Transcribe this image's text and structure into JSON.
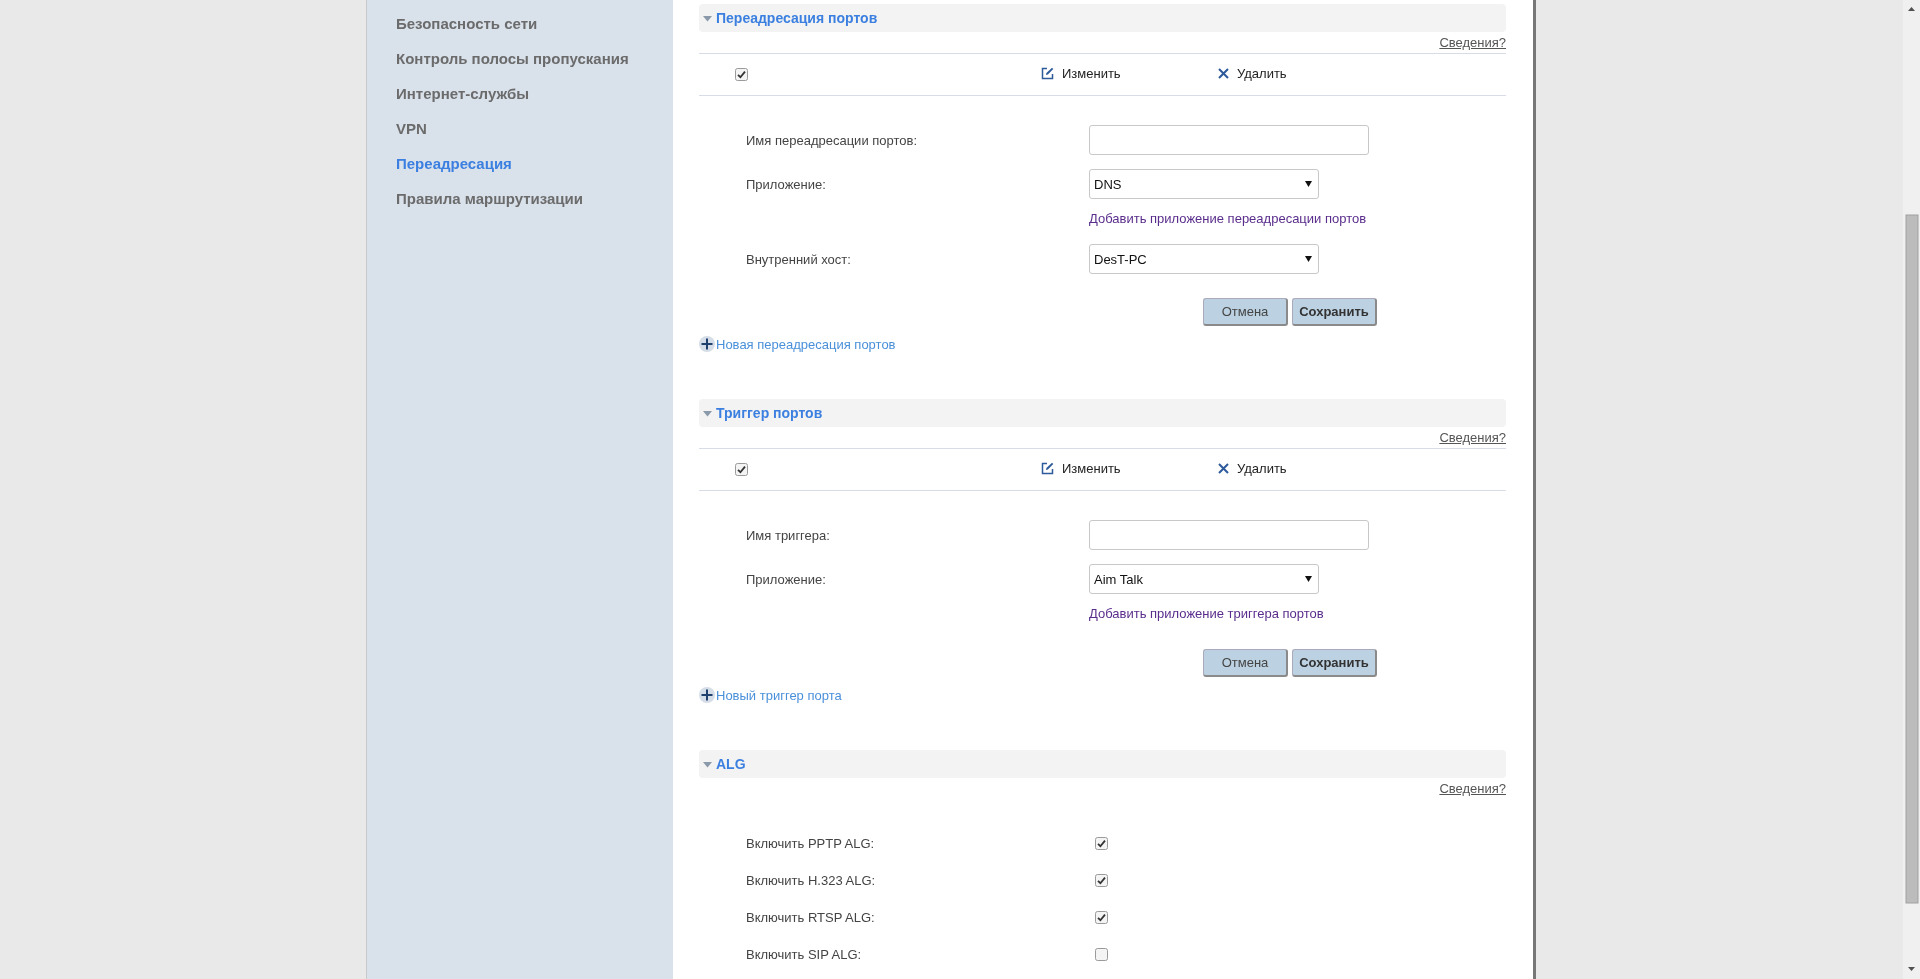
{
  "sidebar": {
    "items": [
      {
        "label": "Безопасность сети",
        "selected": false
      },
      {
        "label": "Контроль полосы пропускания",
        "selected": false
      },
      {
        "label": "Интернет-службы",
        "selected": false
      },
      {
        "label": "VPN",
        "selected": false
      },
      {
        "label": "Переадресация",
        "selected": true
      },
      {
        "label": "Правила маршрутизации",
        "selected": false
      }
    ]
  },
  "sections": [
    {
      "kind": "list-form",
      "title": "Переадресация портов",
      "expanded": true,
      "help_link": "Сведения?",
      "toolbar": {
        "select_all_checked": true,
        "edit": "Изменить",
        "delete": "Удалить"
      },
      "fields": [
        {
          "kind": "text",
          "label": "Имя переадресации портов:"
        },
        {
          "kind": "select",
          "label": "Приложение:",
          "value": "DNS",
          "link": "Добавить приложение переадресации портов"
        },
        {
          "kind": "select",
          "label": "Внутренний хост:",
          "value": "DesT-PC"
        }
      ],
      "buttons": [
        "Отмена",
        "Сохранить"
      ],
      "add_link": "Новая переадресация портов"
    },
    {
      "kind": "list-form",
      "title": "Триггер портов",
      "expanded": true,
      "help_link": "Сведения?",
      "toolbar": {
        "select_all_checked": true,
        "edit": "Изменить",
        "delete": "Удалить"
      },
      "fields": [
        {
          "kind": "text",
          "label": "Имя триггера:"
        },
        {
          "kind": "select",
          "label": "Приложение:",
          "value": "Aim Talk",
          "link": "Добавить приложение триггера портов"
        }
      ],
      "buttons": [
        "Отмена",
        "Сохранить"
      ],
      "add_link": "Новый триггер порта"
    },
    {
      "kind": "checks",
      "title": "ALG",
      "expanded": true,
      "help_link": "Сведения?",
      "rows": [
        {
          "label": "Включить PPTP ALG:",
          "checked": true
        },
        {
          "label": "Включить H.323 ALG:",
          "checked": true
        },
        {
          "label": "Включить RTSP ALG:",
          "checked": true
        },
        {
          "label": "Включить SIP ALG:",
          "checked": false
        }
      ]
    }
  ]
}
